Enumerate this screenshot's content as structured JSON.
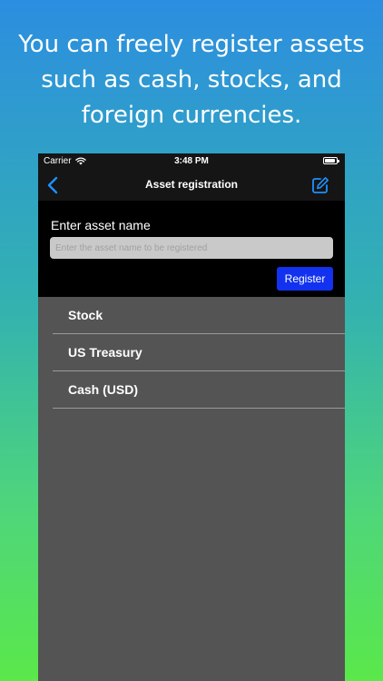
{
  "headline": "You can freely register assets\nsuch as cash, stocks, and\nforeign currencies.",
  "status_bar": {
    "carrier": "Carrier",
    "time": "3:48 PM"
  },
  "nav": {
    "title": "Asset registration",
    "back_icon": "chevron-left-icon",
    "edit_icon": "compose-icon",
    "accent_color": "#1e90ff"
  },
  "form": {
    "label": "Enter asset name",
    "input_value": "",
    "input_placeholder": "Enter the asset name to be registered",
    "register_label": "Register",
    "register_color": "#1232f0"
  },
  "assets": [
    {
      "name": "Stock"
    },
    {
      "name": "US Treasury"
    },
    {
      "name": "Cash (USD)"
    }
  ]
}
